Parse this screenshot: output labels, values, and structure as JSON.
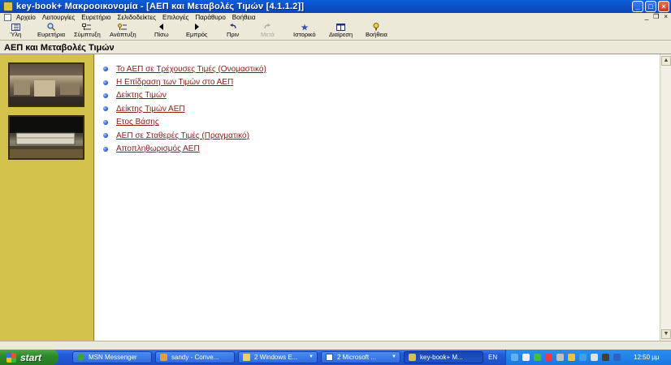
{
  "window": {
    "title": "key-book+   Μακροοικονομία - [ΑΕΠ και Μεταβολές Τιμών  [4.1.1.2]]"
  },
  "menu": [
    "Αρχείο",
    "Λειτουργίες",
    "Ευρετήριο",
    "Σελιδοδείκτες",
    "Επιλογές",
    "Παράθυρο",
    "Βοήθεια"
  ],
  "toolbar": {
    "buttons": [
      {
        "label": "Ύλη",
        "icon": "contents-icon",
        "enabled": true
      },
      {
        "label": "Ευρετήρια",
        "icon": "search-icon",
        "enabled": true
      },
      {
        "label": "Σύμπτυξη",
        "icon": "collapse-icon",
        "enabled": true
      },
      {
        "label": "Ανάπτυξη",
        "icon": "expand-icon",
        "enabled": true
      },
      {
        "label": "Πίσω",
        "icon": "back-arrow-icon",
        "enabled": true
      },
      {
        "label": "Εμπρός",
        "icon": "forward-arrow-icon",
        "enabled": true
      },
      {
        "label": "Πριν",
        "icon": "previous-icon",
        "enabled": true
      },
      {
        "label": "Μετά",
        "icon": "next-icon",
        "enabled": false
      },
      {
        "label": "Ιστορικό",
        "icon": "history-icon",
        "enabled": true
      },
      {
        "label": "Διαίρεση",
        "icon": "split-icon",
        "enabled": true
      },
      {
        "label": "Βοήθεια",
        "icon": "help-icon",
        "enabled": true
      }
    ]
  },
  "page": {
    "title": "ΑΕΠ και Μεταβολές Τιμών",
    "topics": [
      "Το ΑΕΠ σε Τρέχουσες Τιμές (Ονομαστικό)",
      "Η Επίδραση των Τιμών στο ΑΕΠ",
      "Δείκτης Τιμών",
      "Δείκτης Τιμών ΑΕΠ",
      "Ετος Βάσης",
      "ΑΕΠ σε Σταθερές Τιμές (Πραγματικό)",
      "Αποπληθωρισμός ΑΕΠ"
    ]
  },
  "taskbar": {
    "start_label": "start",
    "tasks": [
      {
        "label": "MSN Messenger",
        "icon": "msn-icon",
        "active": false
      },
      {
        "label": "sandy - Conve...",
        "icon": "chat-icon",
        "active": false
      },
      {
        "label": "2 Windows E...",
        "icon": "folder-icon",
        "active": false
      },
      {
        "label": "2 Microsoft ...",
        "icon": "word-icon",
        "active": false
      },
      {
        "label": "key-book+  Μ...",
        "icon": "keybook-icon",
        "active": true
      }
    ],
    "language": "EN",
    "clock": "12:50 μμ"
  },
  "colors": {
    "titlebar": "#0d53c9",
    "left_panel": "#d2c14a",
    "link": "#8a1a14",
    "taskbar": "#245cd8",
    "start_button": "#2e8a2c"
  }
}
